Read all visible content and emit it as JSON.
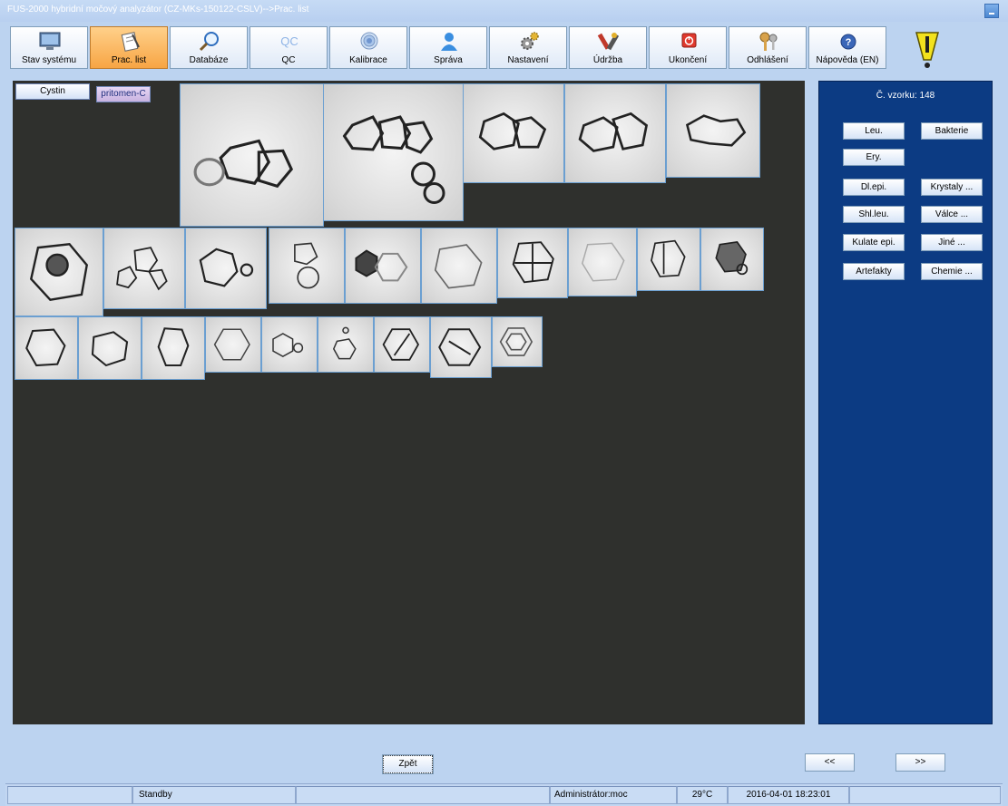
{
  "window": {
    "title": "FUS-2000 hybridní močový analyzátor (CZ-MKs-150122-CSLV)-->Prac. list"
  },
  "toolbar": {
    "items": [
      {
        "label": "Stav systému",
        "icon": "monitor-icon"
      },
      {
        "label": "Prac. list",
        "icon": "worksheet-icon"
      },
      {
        "label": "Databáze",
        "icon": "magnifier-icon"
      },
      {
        "label": "QC",
        "icon": "qc-icon"
      },
      {
        "label": "Kalibrace",
        "icon": "target-icon"
      },
      {
        "label": "Správa",
        "icon": "user-icon"
      },
      {
        "label": "Nastavení",
        "icon": "gears-icon"
      },
      {
        "label": "Údržba",
        "icon": "tools-icon"
      },
      {
        "label": "Ukončení",
        "icon": "power-icon"
      },
      {
        "label": "Odhlášení",
        "icon": "keys-icon"
      },
      {
        "label": "Nápověda (EN)",
        "icon": "help-icon"
      }
    ],
    "active": "Prac. list",
    "qc_icon_text": "QC"
  },
  "viewer": {
    "category_button": "Cystin",
    "status_tag": "pritomen-C",
    "image_count": 26
  },
  "side_panel": {
    "sample_label": "Č. vzorku: 148",
    "buttons_left": [
      "Leu.",
      "Ery.",
      "Dl.epi.",
      "Shl.leu.",
      "Kulate epi.",
      "Artefakty"
    ],
    "buttons_right": [
      "Bakterie",
      "Krystaly ...",
      "Válce ...",
      "Jiné ...",
      "Chemie ..."
    ]
  },
  "navigation": {
    "back": "Zpět",
    "prev": "<<",
    "next": ">>"
  },
  "statusbar": {
    "state": "Standby",
    "user": "Administrátor:moc",
    "temperature": "29°C",
    "datetime": "2016-04-01 18:23:01"
  },
  "colors": {
    "background": "#bcd3f0",
    "viewer_bg": "#2f302d",
    "side_panel_bg": "#0c3b83",
    "active_tab": "#f7a544"
  }
}
